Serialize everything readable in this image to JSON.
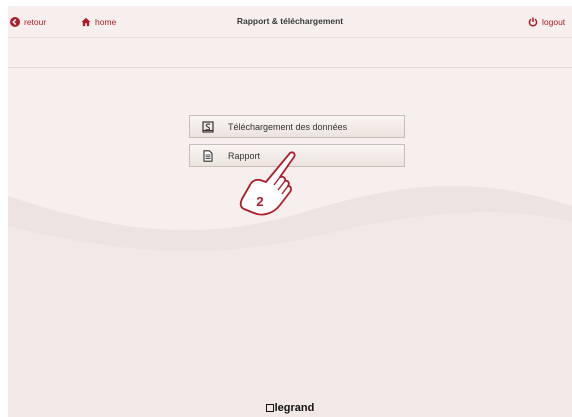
{
  "header": {
    "back_label": "retour",
    "home_label": "home",
    "title": "Rapport & téléchargement",
    "logout_label": "logout"
  },
  "menu": {
    "items": [
      {
        "label": "Téléchargement des données",
        "icon": "download-data-icon"
      },
      {
        "label": "Rapport",
        "icon": "report-document-icon"
      }
    ]
  },
  "annotation": {
    "step_number": "2",
    "icon": "pointing-hand-icon"
  },
  "footer": {
    "brand": "legrand"
  },
  "colors": {
    "accent": "#b01d2a",
    "background": "#f6efed",
    "button_border": "#c9bdb8"
  }
}
